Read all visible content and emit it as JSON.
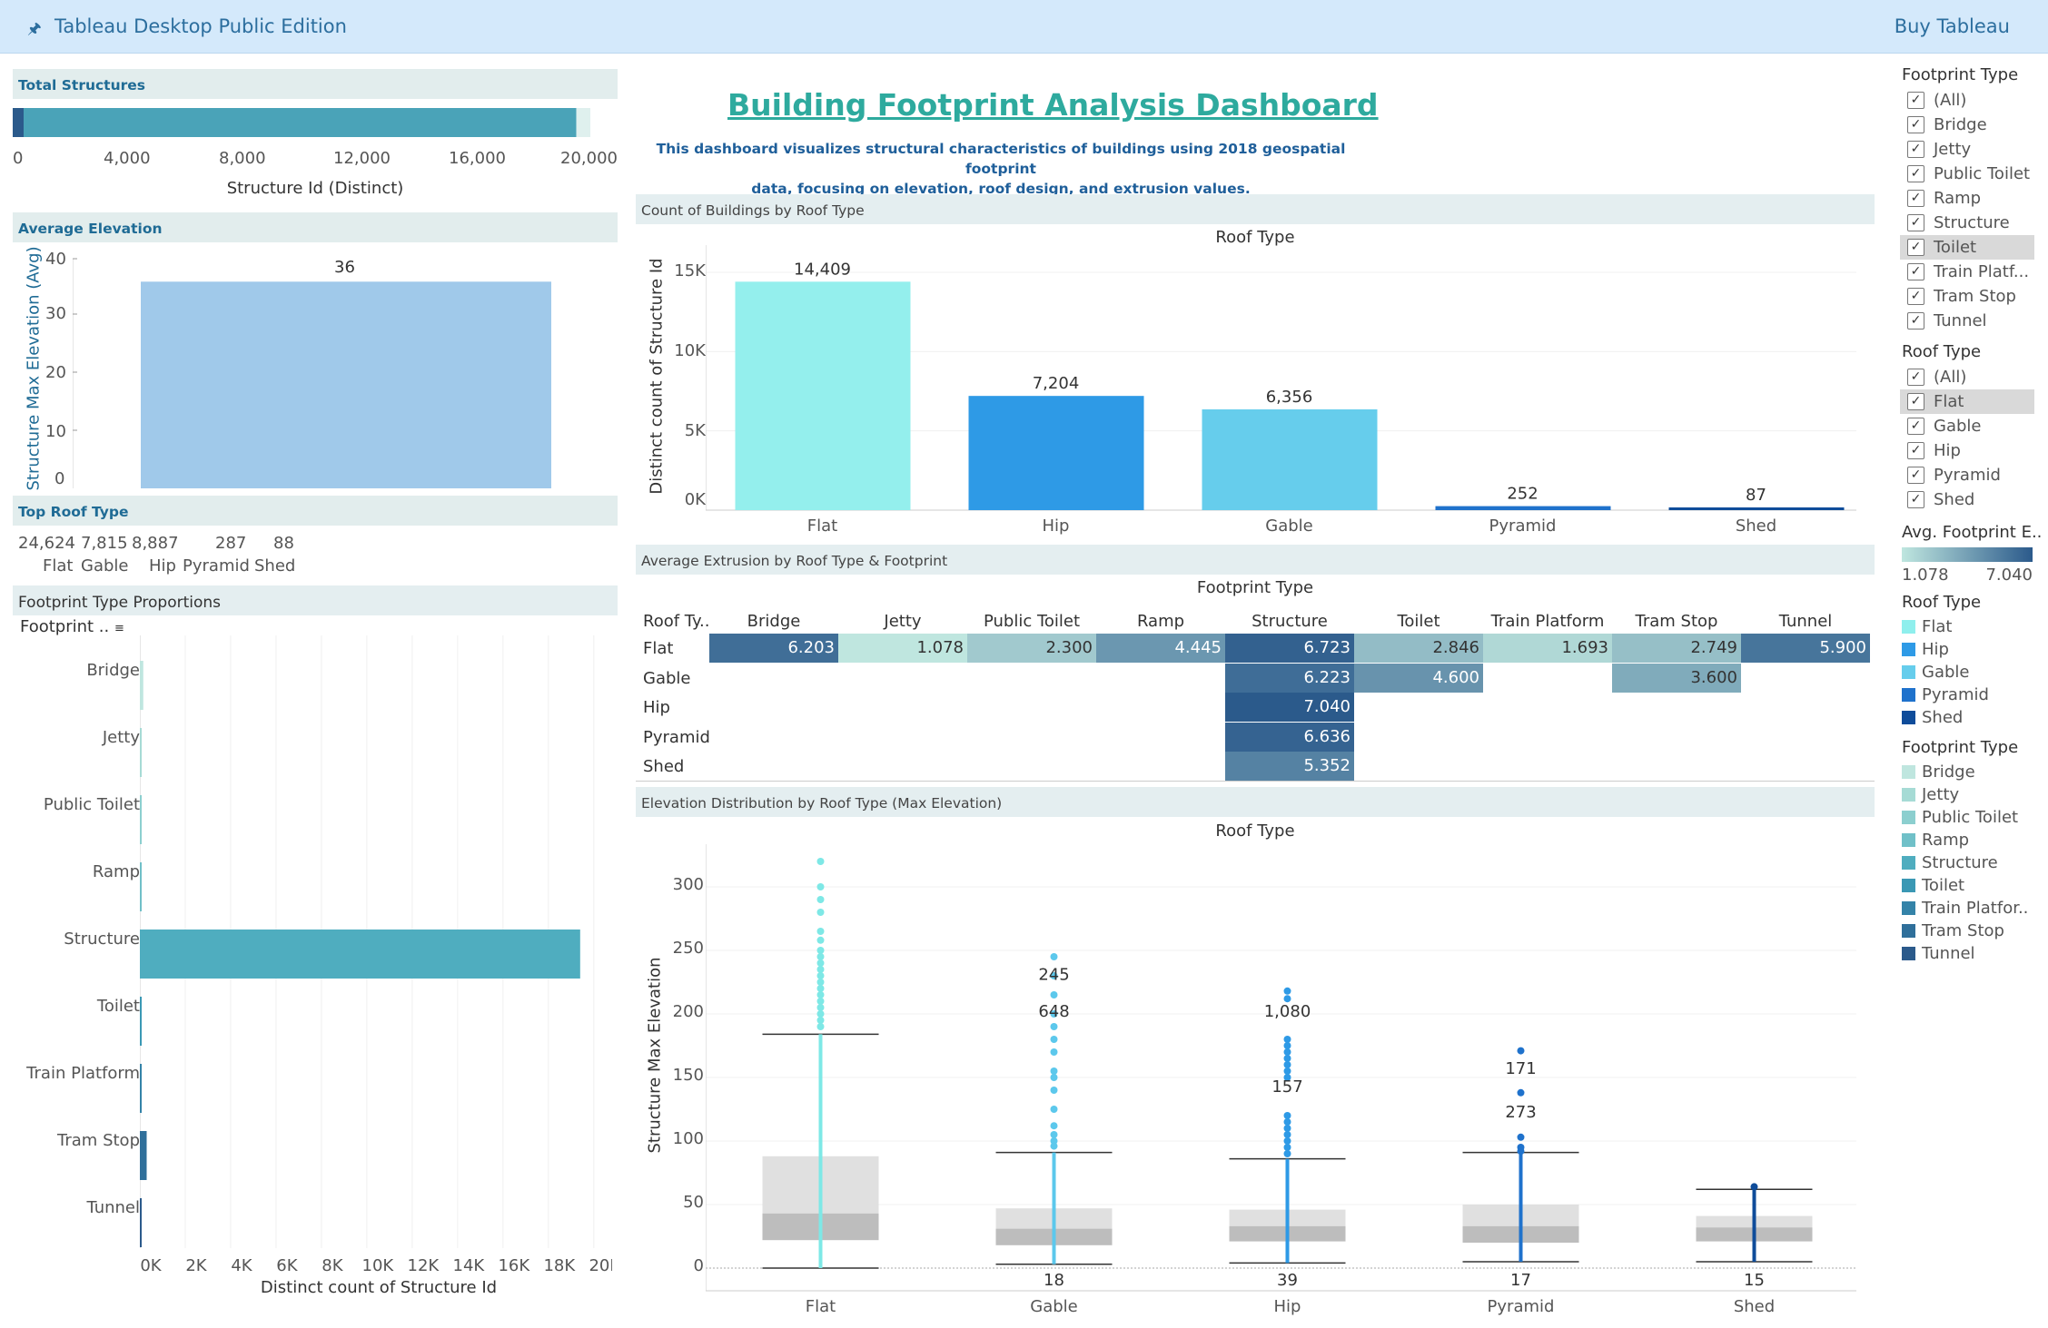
{
  "app": {
    "title": "Tableau Desktop Public Edition",
    "buy": "Buy Tableau"
  },
  "total_structures": {
    "header": "Total Structures",
    "xlabel": "Structure Id (Distinct)",
    "ticks": [
      "0",
      "4,000",
      "8,000",
      "12,000",
      "16,000",
      "20,000"
    ]
  },
  "avg_elevation": {
    "header": "Average Elevation",
    "ylabel": "Structure Max Elevation (Avg)",
    "ticks": [
      "40",
      "30",
      "20",
      "10",
      "0"
    ],
    "value_label": "36"
  },
  "top_roof": {
    "header": "Top Roof Type",
    "items": [
      {
        "value": "24,624",
        "label": "Flat"
      },
      {
        "value": "7,815",
        "label": "Gable"
      },
      {
        "value": "8,887",
        "label": "Hip"
      },
      {
        "value": "287",
        "label": "Pyramid"
      },
      {
        "value": "88",
        "label": "Shed"
      }
    ]
  },
  "footprint_props": {
    "header": "Footprint Type Proportions",
    "col_header": "Footprint ..",
    "xlabel": "Distinct count of Structure Id",
    "ticks": [
      "0K",
      "2K",
      "4K",
      "6K",
      "8K",
      "10K",
      "12K",
      "14K",
      "16K",
      "18K",
      "20K"
    ]
  },
  "dashboard": {
    "title": "Building Footprint Analysis Dashboard",
    "subtitle_line1": "This dashboard visualizes structural characteristics of buildings using 2018 geospatial footprint",
    "subtitle_line2": "data, focusing on elevation, roof design, and extrusion values."
  },
  "roof_count": {
    "header": "Count of Buildings by Roof Type",
    "top_label": "Roof Type",
    "ylabel": "Distinct count of Structure Id",
    "ticks": [
      "15K",
      "10K",
      "5K",
      "0K"
    ]
  },
  "extrusion": {
    "header": "Average Extrusion by Roof Type & Footprint",
    "top_label": "Footprint Type",
    "row_header": "Roof Ty..",
    "columns": [
      "Bridge",
      "Jetty",
      "Public Toilet",
      "Ramp",
      "Structure",
      "Toilet",
      "Train Platform",
      "Tram Stop",
      "Tunnel"
    ],
    "rows": [
      {
        "name": "Flat",
        "cells": [
          "6.203",
          "1.078",
          "2.300",
          "4.445",
          "6.723",
          "2.846",
          "1.693",
          "2.749",
          "5.900"
        ]
      },
      {
        "name": "Gable",
        "cells": [
          "",
          "",
          "",
          "",
          "6.223",
          "4.600",
          "",
          "3.600",
          ""
        ]
      },
      {
        "name": "Hip",
        "cells": [
          "",
          "",
          "",
          "",
          "7.040",
          "",
          "",
          "",
          ""
        ]
      },
      {
        "name": "Pyramid",
        "cells": [
          "",
          "",
          "",
          "",
          "6.636",
          "",
          "",
          "",
          ""
        ]
      },
      {
        "name": "Shed",
        "cells": [
          "",
          "",
          "",
          "",
          "5.352",
          "",
          "",
          "",
          ""
        ]
      }
    ]
  },
  "elevation_dist": {
    "header": "Elevation Distribution by Roof Type (Max Elevation)",
    "top_label": "Roof Type",
    "ylabel": "Structure Max Elevation",
    "ticks": [
      "300",
      "250",
      "200",
      "150",
      "100",
      "50",
      "0"
    ]
  },
  "filters": {
    "footprint": {
      "title": "Footprint Type",
      "items": [
        "(All)",
        "Bridge",
        "Jetty",
        "Public Toilet",
        "Ramp",
        "Structure",
        "Toilet",
        "Train Platf...",
        "Tram Stop",
        "Tunnel"
      ]
    },
    "roof": {
      "title": "Roof Type",
      "items": [
        "(All)",
        "Flat",
        "Gable",
        "Hip",
        "Pyramid",
        "Shed"
      ]
    },
    "avg_legend": {
      "title": "Avg. Footprint E..",
      "min": "1.078",
      "max": "7.040"
    },
    "roof_legend": {
      "title": "Roof Type",
      "items": [
        {
          "label": "Flat",
          "color": "#8fefed"
        },
        {
          "label": "Hip",
          "color": "#2e9ae6"
        },
        {
          "label": "Gable",
          "color": "#66cdec"
        },
        {
          "label": "Pyramid",
          "color": "#1f72cc"
        },
        {
          "label": "Shed",
          "color": "#0f4c9a"
        }
      ]
    },
    "fp_legend": {
      "title": "Footprint Type",
      "items": [
        {
          "label": "Bridge",
          "color": "#bfe6df"
        },
        {
          "label": "Jetty",
          "color": "#a6dbd5"
        },
        {
          "label": "Public Toilet",
          "color": "#8ccfcf"
        },
        {
          "label": "Ramp",
          "color": "#70c0c8"
        },
        {
          "label": "Structure",
          "color": "#4fadbf"
        },
        {
          "label": "Toilet",
          "color": "#3a98b4"
        },
        {
          "label": "Train Platfor..",
          "color": "#3483a8"
        },
        {
          "label": "Tram Stop",
          "color": "#2f6f9a"
        },
        {
          "label": "Tunnel",
          "color": "#2b5a8b"
        }
      ]
    }
  },
  "chart_data": [
    {
      "type": "bar",
      "id": "total_structures",
      "orientation": "horizontal",
      "values": [
        20000
      ],
      "xlim": [
        0,
        20500
      ],
      "xlabel": "Structure Id (Distinct)"
    },
    {
      "type": "bar",
      "id": "avg_elevation",
      "values": [
        36
      ],
      "ylim": [
        0,
        40
      ],
      "ylabel": "Structure Max Elevation (Avg)"
    },
    {
      "type": "bar",
      "id": "footprint_proportions",
      "orientation": "horizontal",
      "categories": [
        "Bridge",
        "Jetty",
        "Public Toilet",
        "Ramp",
        "Structure",
        "Toilet",
        "Train Platform",
        "Tram Stop",
        "Tunnel"
      ],
      "values": [
        150,
        60,
        20,
        10,
        19400,
        20,
        15,
        300,
        10
      ],
      "xlim": [
        0,
        20000
      ],
      "xlabel": "Distinct count of Structure Id"
    },
    {
      "type": "bar",
      "id": "roof_count",
      "title": "Count of Buildings by Roof Type",
      "categories": [
        "Flat",
        "Hip",
        "Gable",
        "Pyramid",
        "Shed"
      ],
      "values": [
        14409,
        7204,
        6356,
        252,
        87
      ],
      "labels": [
        "14,409",
        "7,204",
        "6,356",
        "252",
        "87"
      ],
      "colors": [
        "#94efed",
        "#2e9ae6",
        "#66cdec",
        "#1f72cc",
        "#0f4c9a"
      ],
      "ylim": [
        0,
        15000
      ],
      "ylabel": "Distinct count of Structure Id"
    },
    {
      "type": "heatmap",
      "id": "extrusion",
      "rows": [
        "Flat",
        "Gable",
        "Hip",
        "Pyramid",
        "Shed"
      ],
      "columns": [
        "Bridge",
        "Jetty",
        "Public Toilet",
        "Ramp",
        "Structure",
        "Toilet",
        "Train Platform",
        "Tram Stop",
        "Tunnel"
      ],
      "values": [
        [
          6.203,
          1.078,
          2.3,
          4.445,
          6.723,
          2.846,
          1.693,
          2.749,
          5.9
        ],
        [
          null,
          null,
          null,
          null,
          6.223,
          4.6,
          null,
          3.6,
          null
        ],
        [
          null,
          null,
          null,
          null,
          7.04,
          null,
          null,
          null,
          null
        ],
        [
          null,
          null,
          null,
          null,
          6.636,
          null,
          null,
          null,
          null
        ],
        [
          null,
          null,
          null,
          null,
          5.352,
          null,
          null,
          null,
          null
        ]
      ],
      "vmin": 1.078,
      "vmax": 7.04
    },
    {
      "type": "scatter",
      "id": "elevation_boxplot",
      "categories": [
        "Flat",
        "Gable",
        "Hip",
        "Pyramid",
        "Shed"
      ],
      "colors": [
        "#7ee8e6",
        "#5cc8ec",
        "#2e9ae6",
        "#1f72cc",
        "#0f4c9a"
      ],
      "ylim": [
        0,
        320
      ],
      "ylabel": "Structure Max Elevation",
      "boxes": [
        {
          "whisker_low": 0,
          "q1": 22,
          "median": 43,
          "q3": 88,
          "whisker_high": 184
        },
        {
          "whisker_low": 3,
          "q1": 18,
          "median": 31,
          "q3": 47,
          "whisker_high": 91
        },
        {
          "whisker_low": 4,
          "q1": 21,
          "median": 33,
          "q3": 46,
          "whisker_high": 86
        },
        {
          "whisker_low": 5,
          "q1": 20,
          "median": 33,
          "q3": 50,
          "whisker_high": 91
        },
        {
          "whisker_low": 5,
          "q1": 21,
          "median": 32,
          "q3": 41,
          "whisker_high": 62
        }
      ],
      "outliers": [
        [
          320,
          300,
          290,
          280,
          265,
          258,
          250,
          245,
          240,
          235,
          230,
          225,
          220,
          215,
          210,
          205,
          200,
          195,
          190
        ],
        [
          245,
          230,
          215,
          200,
          190,
          180,
          170,
          155,
          150,
          140,
          125,
          112,
          105,
          100,
          96
        ],
        [
          218,
          212,
          180,
          175,
          170,
          165,
          160,
          155,
          150,
          120,
          115,
          110,
          105,
          100,
          95,
          90
        ],
        [
          171,
          138,
          103,
          95,
          92
        ],
        [
          64
        ]
      ],
      "annotations": [
        {
          "category": "Gable",
          "y": 231,
          "text": "245"
        },
        {
          "category": "Gable",
          "y": 202,
          "text": "648"
        },
        {
          "category": "Hip",
          "y": 202,
          "text": "1,080"
        },
        {
          "category": "Hip",
          "y": 143,
          "text": "157"
        },
        {
          "category": "Pyramid",
          "y": 157,
          "text": "171"
        },
        {
          "category": "Pyramid",
          "y": 123,
          "text": "273"
        }
      ],
      "bottom_labels": [
        {
          "category": "Gable",
          "text": "18"
        },
        {
          "category": "Hip",
          "text": "39"
        },
        {
          "category": "Pyramid",
          "text": "17"
        },
        {
          "category": "Shed",
          "text": "15"
        }
      ]
    }
  ]
}
